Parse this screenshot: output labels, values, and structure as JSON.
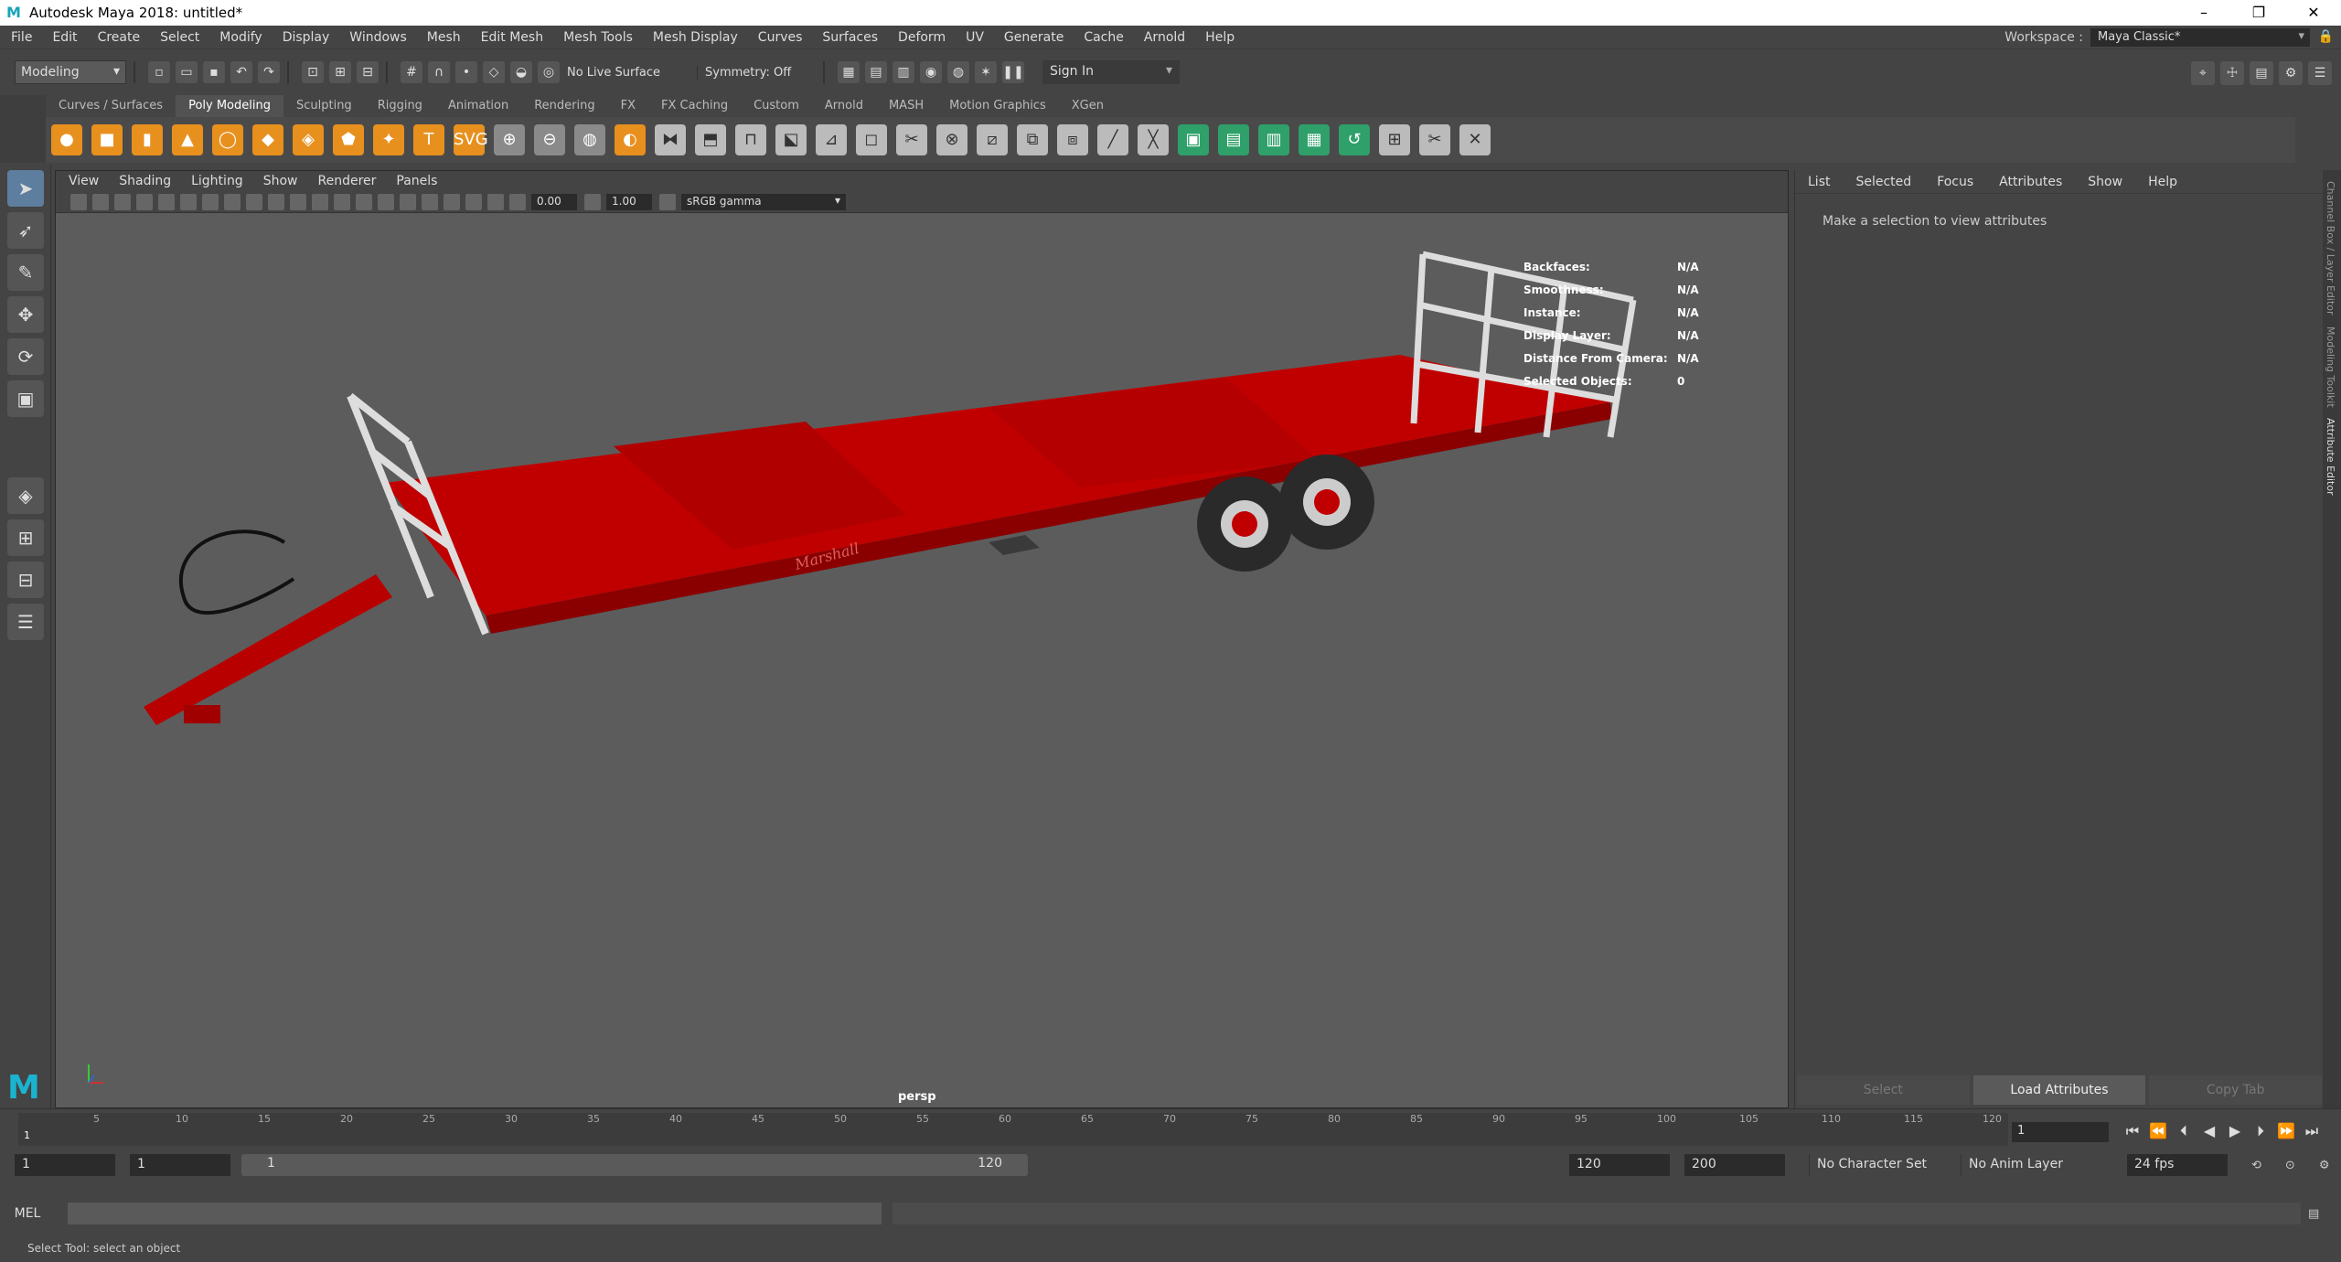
{
  "window": {
    "title": "Autodesk Maya 2018: untitled*",
    "app_icon": "maya-icon"
  },
  "window_controls": {
    "minimize": "–",
    "maximize": "❐",
    "close": "✕"
  },
  "menubar": {
    "items": [
      "File",
      "Edit",
      "Create",
      "Select",
      "Modify",
      "Display",
      "Windows",
      "Mesh",
      "Edit Mesh",
      "Mesh Tools",
      "Mesh Display",
      "Curves",
      "Surfaces",
      "Deform",
      "UV",
      "Generate",
      "Cache",
      "Arnold",
      "Help"
    ]
  },
  "workspace": {
    "label": "Workspace :",
    "value": "Maya Classic*"
  },
  "status_line": {
    "mode": "Modeling",
    "live_surface": "No Live Surface",
    "symmetry": "Symmetry: Off",
    "sign_in": "Sign In"
  },
  "shelf": {
    "tabs": [
      "Curves / Surfaces",
      "Poly Modeling",
      "Sculpting",
      "Rigging",
      "Animation",
      "Rendering",
      "FX",
      "FX Caching",
      "Custom",
      "Arnold",
      "MASH",
      "Motion Graphics",
      "XGen"
    ],
    "active_tab": "Poly Modeling",
    "svg_label": "SVG",
    "text_label": "T"
  },
  "viewport": {
    "menu": [
      "View",
      "Shading",
      "Lighting",
      "Show",
      "Renderer",
      "Panels"
    ],
    "exposure": "0.00",
    "gamma": "1.00",
    "color_space": "sRGB gamma",
    "camera": "persp",
    "hud": [
      {
        "key": "Backfaces:",
        "value": "N/A"
      },
      {
        "key": "Smoothness:",
        "value": "N/A"
      },
      {
        "key": "Instance:",
        "value": "N/A"
      },
      {
        "key": "Display Layer:",
        "value": "N/A"
      },
      {
        "key": "Distance From Camera:",
        "value": "N/A"
      },
      {
        "key": "Selected Objects:",
        "value": "0"
      }
    ],
    "trailer_brand": "Marshall",
    "colors": {
      "trailer_red": "#c40000",
      "viewport_bg": "#5c5c5c"
    }
  },
  "attribute_editor": {
    "menu": [
      "List",
      "Selected",
      "Focus",
      "Attributes",
      "Show",
      "Help"
    ],
    "message": "Make a selection to view attributes",
    "buttons": {
      "select": "Select",
      "load": "Load Attributes",
      "copy": "Copy Tab"
    }
  },
  "side_tabs": [
    "Channel Box / Layer Editor",
    "Modeling Toolkit",
    "Attribute Editor"
  ],
  "time_slider": {
    "ticks": [
      "1",
      "5",
      "10",
      "15",
      "20",
      "25",
      "30",
      "35",
      "40",
      "45",
      "50",
      "55",
      "60",
      "65",
      "70",
      "75",
      "80",
      "85",
      "90",
      "95",
      "100",
      "105",
      "110",
      "115",
      "120"
    ],
    "current_frame": "1"
  },
  "range_slider": {
    "start": "1",
    "playback_start": "1",
    "bar_low": "1",
    "bar_high": "120",
    "playback_end": "120",
    "end": "200",
    "character_set": "No Character Set",
    "anim_layer": "No Anim Layer",
    "fps": "24 fps"
  },
  "command_line": {
    "label": "MEL"
  },
  "help_line": {
    "text": "Select Tool: select an object"
  }
}
